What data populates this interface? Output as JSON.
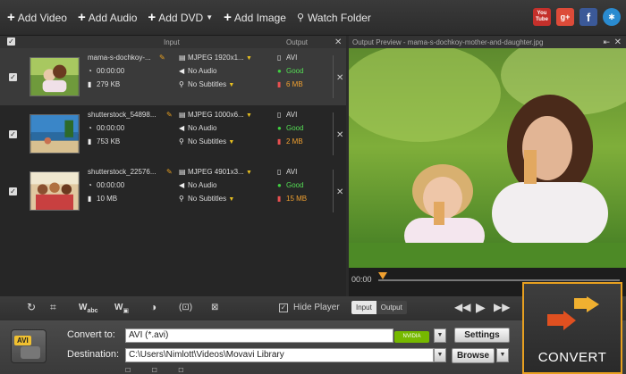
{
  "toolbar": {
    "add_video": "Add Video",
    "add_audio": "Add Audio",
    "add_dvd": "Add DVD",
    "add_image": "Add Image",
    "watch_folder": "Watch Folder"
  },
  "list_header": {
    "input": "Input",
    "output": "Output"
  },
  "files": [
    {
      "name": "mama-s-dochkoy-...",
      "duration": "00:00:00",
      "size": "279 KB",
      "codec": "MJPEG 1920x1...",
      "audio": "No Audio",
      "subtitles": "No Subtitles",
      "out_format": "AVI",
      "quality": "Good",
      "out_size": "6 MB"
    },
    {
      "name": "shutterstock_54898...",
      "duration": "00:00:00",
      "size": "753 KB",
      "codec": "MJPEG 1000x6...",
      "audio": "No Audio",
      "subtitles": "No Subtitles",
      "out_format": "AVI",
      "quality": "Good",
      "out_size": "2 MB"
    },
    {
      "name": "shutterstock_22576...",
      "duration": "00:00:00",
      "size": "10 MB",
      "codec": "MJPEG 4901x3...",
      "audio": "No Audio",
      "subtitles": "No Subtitles",
      "out_format": "AVI",
      "quality": "Good",
      "out_size": "15 MB"
    }
  ],
  "preview": {
    "title": "Output Preview - mama-s-dochkoy-mother-and-daughter.jpg",
    "time": "00:00"
  },
  "controls": {
    "hide_player": "Hide Player",
    "input": "Input",
    "output": "Output"
  },
  "bottom": {
    "format_badge": "AVI",
    "convert_to_label": "Convert to:",
    "convert_to_value": "AVI (*.avi)",
    "destination_label": "Destination:",
    "destination_value": "C:\\Users\\Nimlott\\Videos\\Movavi Library",
    "settings": "Settings",
    "browse": "Browse",
    "convert": "CONVERT"
  },
  "social": {
    "youtube": "You Tube",
    "gplus": "g+",
    "facebook": "f"
  },
  "colors": {
    "accent": "#e8a020",
    "good": "#3fcf3f"
  }
}
